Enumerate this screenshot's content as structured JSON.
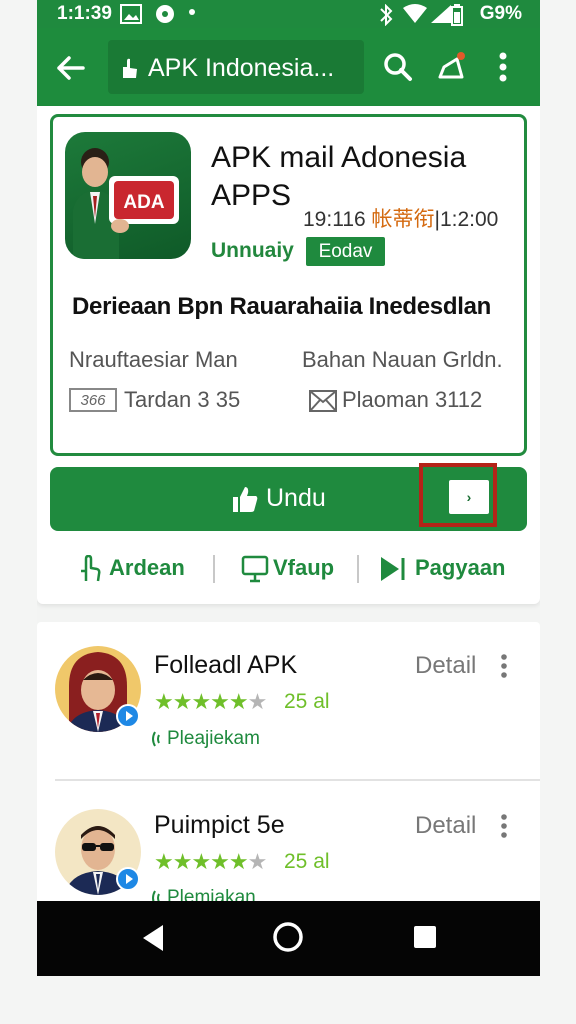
{
  "status_bar": {
    "time": "1:1:39",
    "battery_text": "G9%"
  },
  "app_bar": {
    "url_text": "APK Indonesia..."
  },
  "app_card": {
    "title": "APK mail Adonesia APPS",
    "meta_left": "19:116",
    "meta_accent": "帐蒂衔",
    "meta_right": "|1:2:00",
    "developer": "Unnuaiy",
    "tag_label": "Eodav",
    "icon_sign_text": "ADA",
    "description": "Derieaan Bpn Rauarahaiia Inedesdlan",
    "specs": {
      "left_top": "Nrauftaesiar Man",
      "right_top": "Bahan Nauan Grldn.",
      "left_bottom_badge": "366",
      "left_bottom": "Tardan 3 35",
      "right_bottom": "Plaoman 3112"
    }
  },
  "download": {
    "label": "Undu",
    "arrow": "›"
  },
  "actions": [
    {
      "label": "Ardean",
      "icon": "hand-pointer-icon"
    },
    {
      "label": "Vfaup",
      "icon": "monitor-icon"
    },
    {
      "label": "Pagyaan",
      "icon": "play-icon"
    }
  ],
  "list": [
    {
      "title": "Folleadl APK",
      "detail": "Detail",
      "rating": 4.5,
      "rating_text": "25 al",
      "sub": "Pleajiekam"
    },
    {
      "title": "Puimpict 5e",
      "detail": "Detail",
      "rating": 4.5,
      "rating_text": "25 al",
      "sub": "Plemiakan"
    }
  ],
  "colors": {
    "primary_green": "#1f8a3e",
    "star_green": "#6fbf2a",
    "highlight_red": "#b42318",
    "accent_orange": "#d46a10"
  }
}
